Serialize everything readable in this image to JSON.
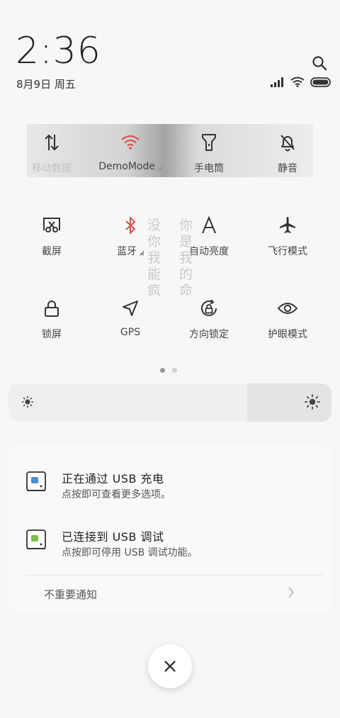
{
  "header": {
    "time": "2:36",
    "date": "8月9日 周五"
  },
  "tiles": [
    {
      "icon": "mobile-data-icon",
      "label": "移动数据",
      "active": false
    },
    {
      "icon": "wifi-icon",
      "label": "DemoMode",
      "active": true
    },
    {
      "icon": "flashlight-icon",
      "label": "手电筒",
      "active": false
    },
    {
      "icon": "mute-icon",
      "label": "静音",
      "active": false
    },
    {
      "icon": "screenshot-icon",
      "label": "截屏",
      "active": false
    },
    {
      "icon": "bluetooth-icon",
      "label": "蓝牙",
      "active": true
    },
    {
      "icon": "auto-brightness-icon",
      "label": "自动亮度",
      "active": false
    },
    {
      "icon": "airplane-icon",
      "label": "飞行模式",
      "active": false
    },
    {
      "icon": "lock-icon",
      "label": "锁屏",
      "active": false
    },
    {
      "icon": "gps-icon",
      "label": "GPS",
      "active": false
    },
    {
      "icon": "rotation-lock-icon",
      "label": "方向锁定",
      "active": false
    },
    {
      "icon": "eye-icon",
      "label": "护眼模式",
      "active": false
    }
  ],
  "wallpaper_text": {
    "col1": "没你我能疯",
    "col2": "你是我的命"
  },
  "pager": {
    "pages": 2,
    "current": 1
  },
  "brightness": {
    "level": 0.26
  },
  "notifications": [
    {
      "title": "正在通过 USB 充电",
      "desc": "点按即可查看更多选项。",
      "icon": "usb-charge-icon"
    },
    {
      "title": "已连接到 USB 调试",
      "desc": "点按即可停用 USB 调试功能。",
      "icon": "usb-debug-icon"
    }
  ],
  "unimportant": {
    "label": "不重要通知"
  },
  "colors": {
    "accent": "#d9534f"
  }
}
